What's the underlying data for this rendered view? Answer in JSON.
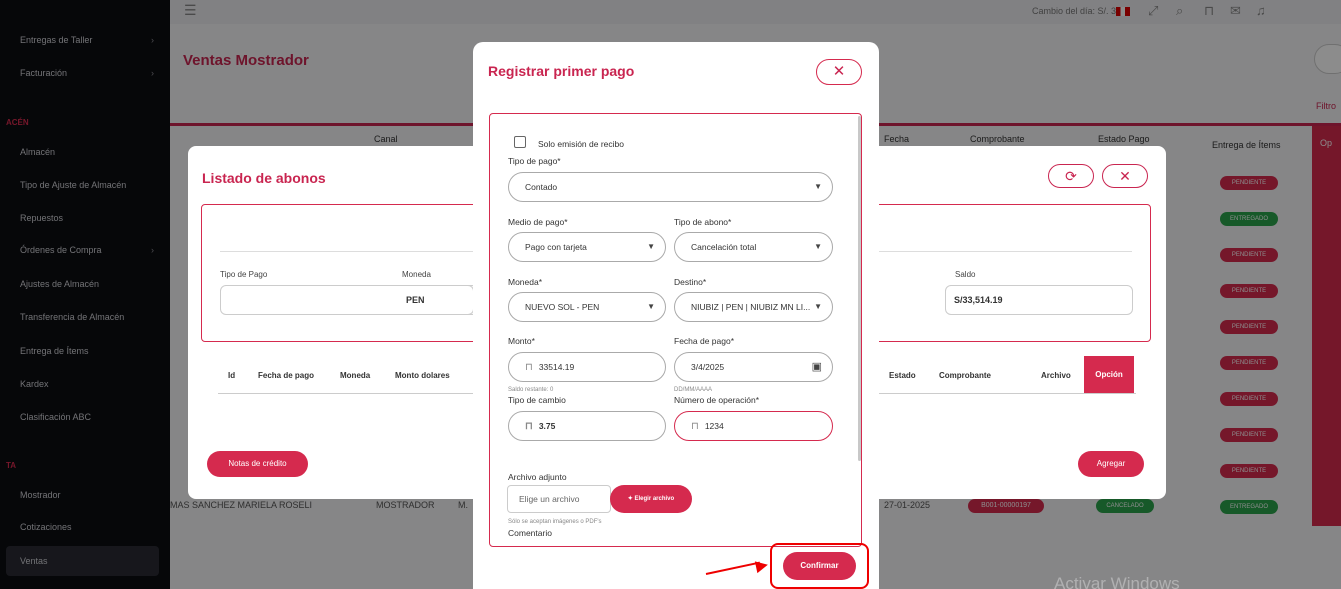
{
  "sidebar": {
    "items": [
      "Entregas de Taller",
      "Facturación",
      "Almacén",
      "Tipo de Ajuste de Almacén",
      "Repuestos",
      "Órdenes de Compra",
      "Ajustes de Almacén",
      "Transferencia de Almacén",
      "Entrega de Ítems",
      "Kardex",
      "Clasificación ABC",
      "Mostrador",
      "Cotizaciones",
      "Ventas"
    ],
    "sections": [
      "ACÉN",
      "TA"
    ],
    "chev": "›"
  },
  "topbar": {
    "rate": "Cambio del día: S/. 3.75"
  },
  "page": {
    "title": "Ventas Mostrador",
    "filter": "Filtro"
  },
  "table": {
    "headers": [
      "Canal",
      "Fecha",
      "Comprobante",
      "Estado Pago",
      "Entrega de Ítems",
      "Op"
    ],
    "status_badges": [
      "PENDIENTE",
      "ENTREGADO",
      "PENDIENTE",
      "PENDIENTE",
      "PENDIENTE",
      "PENDIENTE",
      "PENDIENTE",
      "PENDIENTE",
      "PENDIENTE",
      "ENTREGADO"
    ],
    "last_row": {
      "client": "MAS SANCHEZ MARIELA ROSELI",
      "channel": "MOSTRADOR",
      "sub": "M.",
      "date": "27-01-2025",
      "voucher": "B001-00000197",
      "payment": "CANCELADO"
    }
  },
  "abonos": {
    "title": "Listado de abonos",
    "tipo_pago_label": "Tipo de Pago",
    "moneda_label": "Moneda",
    "moneda_value": "PEN",
    "saldo_label": "Saldo",
    "saldo_value": "S/33,514.19",
    "columns": [
      "Id",
      "Fecha de pago",
      "Moneda",
      "Monto dolares",
      "Estado",
      "Comprobante",
      "Archivo",
      "Opción"
    ],
    "credit_notes": "Notas de crédito",
    "add": "Agregar"
  },
  "payment_modal": {
    "title": "Registrar primer pago",
    "receipt_only": "Solo emisión de recibo",
    "tipo_pago": {
      "label": "Tipo de pago*",
      "value": "Contado"
    },
    "medio_pago": {
      "label": "Medio de pago*",
      "value": "Pago con tarjeta"
    },
    "tipo_abono": {
      "label": "Tipo de abono*",
      "value": "Cancelación total"
    },
    "moneda": {
      "label": "Moneda*",
      "value": "NUEVO SOL - PEN"
    },
    "destino": {
      "label": "Destino*",
      "value": "NIUBIZ | PEN | NIUBIZ MN LI..."
    },
    "monto": {
      "label": "Monto*",
      "value": "33514.19",
      "hint": "Saldo restante: 0"
    },
    "fecha_pago": {
      "label": "Fecha de pago*",
      "value": "3/4/2025",
      "hint": "DD/MM/AAAA"
    },
    "tipo_cambio": {
      "label": "Tipo de cambio",
      "value": "3.75"
    },
    "num_operacion": {
      "label": "Número de operación*",
      "value": "1234"
    },
    "archivo": {
      "label": "Archivo adjunto",
      "placeholder": "Elige un archivo",
      "button": "Elegir archivo",
      "hint": "Sólo se aceptan imágenes o PDF's"
    },
    "comentario_label": "Comentario",
    "confirm": "Confirmar"
  },
  "watermark": "Activar Windows",
  "colors": {
    "accent": "#d52a4e",
    "success": "#2ba24c",
    "sidebar": "#0c0d12"
  }
}
